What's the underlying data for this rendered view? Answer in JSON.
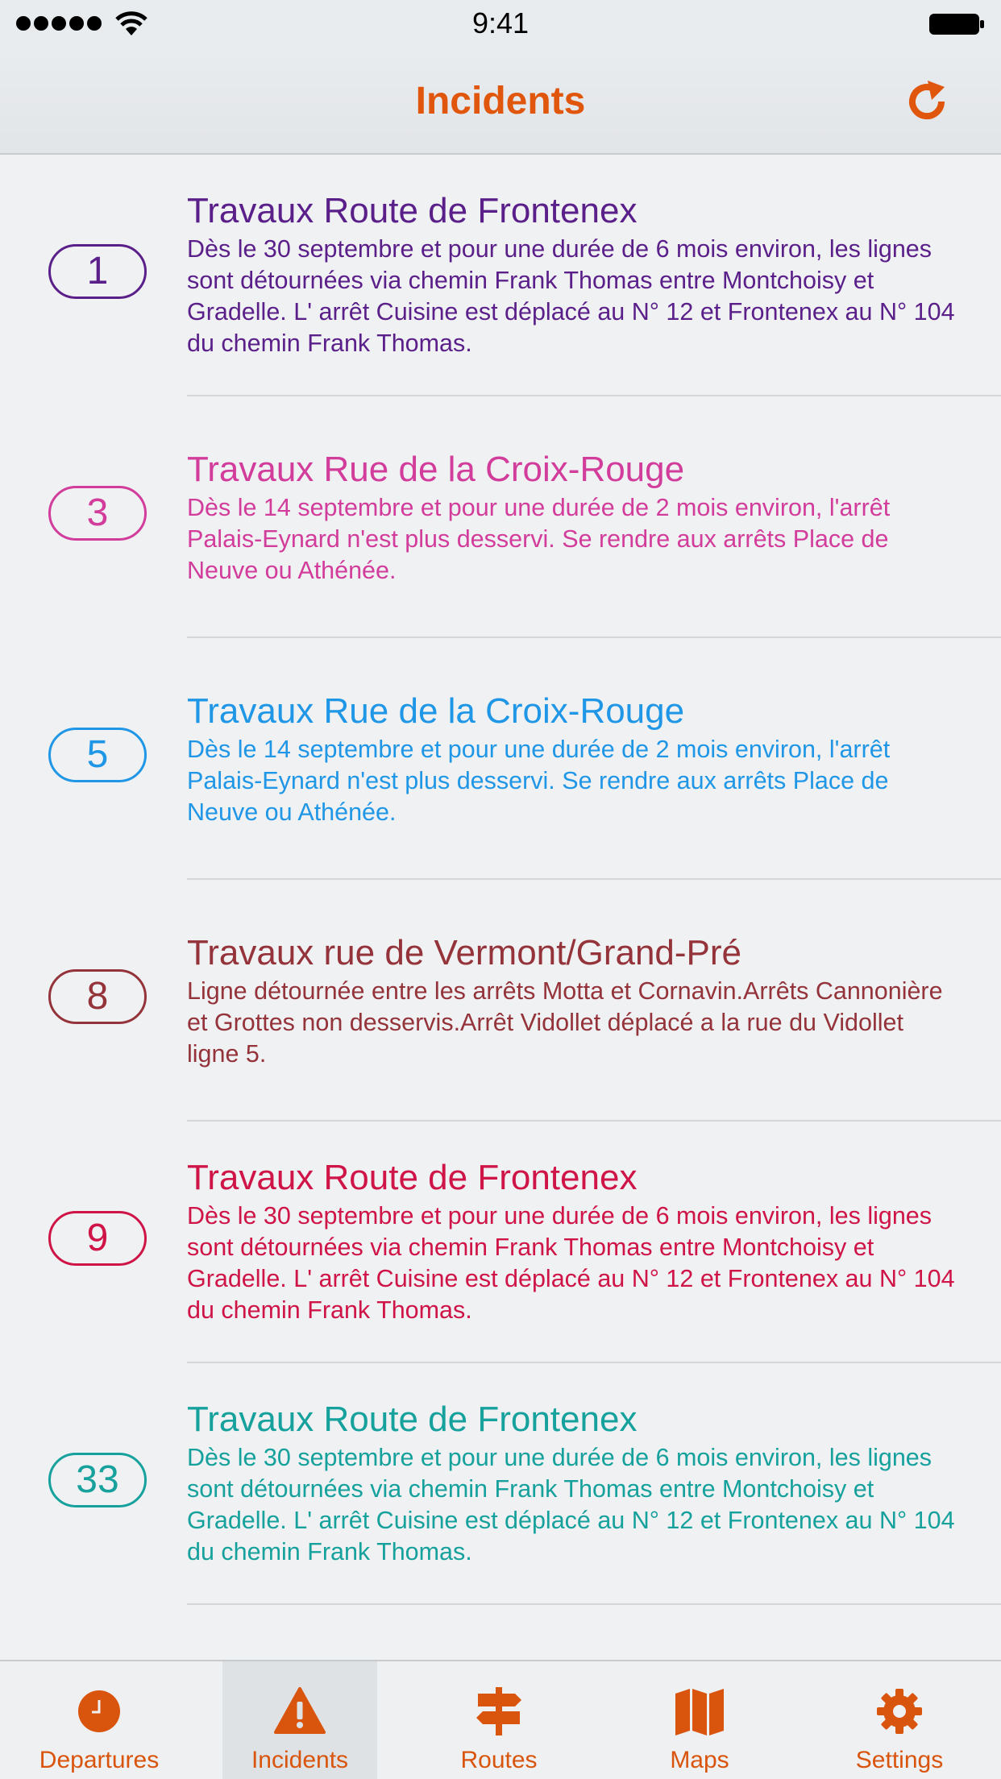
{
  "status_bar": {
    "time": "9:41"
  },
  "nav": {
    "title": "Incidents",
    "refresh_icon": "refresh-icon"
  },
  "colors": {
    "accent": "#e0560c"
  },
  "incidents": [
    {
      "line": "1",
      "color": "#5b1f8a",
      "title": "Travaux Route de Frontenex",
      "description": "Dès le 30 septembre et pour une durée de 6 mois environ, les lignes sont détournées via chemin Frank Thomas entre Montchoisy et Gradelle. L' arrêt Cuisine est déplacé au N° 12 et Frontenex au N° 104 du chemin Frank Thomas."
    },
    {
      "line": "3",
      "color": "#d23c9b",
      "title": "Travaux Rue de la Croix-Rouge",
      "description": "Dès le 14 septembre et pour une durée de 2 mois environ, l'arrêt Palais-Eynard n'est plus desservi. Se rendre aux arrêts Place de Neuve ou Athénée."
    },
    {
      "line": "5",
      "color": "#1f96e6",
      "title": "Travaux Rue de la Croix-Rouge",
      "description": "Dès le 14 septembre et pour une durée de 2 mois environ, l'arrêt Palais-Eynard n'est plus desservi. Se rendre aux arrêts Place de Neuve ou Athénée."
    },
    {
      "line": "8",
      "color": "#94333a",
      "title": "Travaux rue de Vermont/Grand-Pré",
      "description": "Ligne détournée entre les arrêts Motta et Cornavin.Arrêts Cannonière et Grottes non desservis.Arrêt Vidollet déplacé a la rue du Vidollet ligne 5."
    },
    {
      "line": "9",
      "color": "#cf1447",
      "title": "Travaux Route de Frontenex",
      "description": "Dès le 30 septembre et pour une durée de 6 mois environ, les lignes sont détournées via chemin Frank Thomas entre Montchoisy et Gradelle. L' arrêt Cuisine est déplacé au N° 12 et Frontenex au N° 104 du chemin Frank Thomas."
    },
    {
      "line": "33",
      "color": "#16a19d",
      "title": "Travaux Route de Frontenex",
      "description": "Dès le 30 septembre et pour une durée de 6 mois environ, les lignes sont détournées via chemin Frank Thomas entre Montchoisy et Gradelle. L' arrêt Cuisine est déplacé au N° 12 et Frontenex au N° 104 du chemin Frank Thomas."
    }
  ],
  "tabs": [
    {
      "label": "Departures",
      "icon": "clock-icon",
      "active": false
    },
    {
      "label": "Incidents",
      "icon": "warning-icon",
      "active": true
    },
    {
      "label": "Routes",
      "icon": "signpost-icon",
      "active": false
    },
    {
      "label": "Maps",
      "icon": "map-icon",
      "active": false
    },
    {
      "label": "Settings",
      "icon": "gear-icon",
      "active": false
    }
  ]
}
